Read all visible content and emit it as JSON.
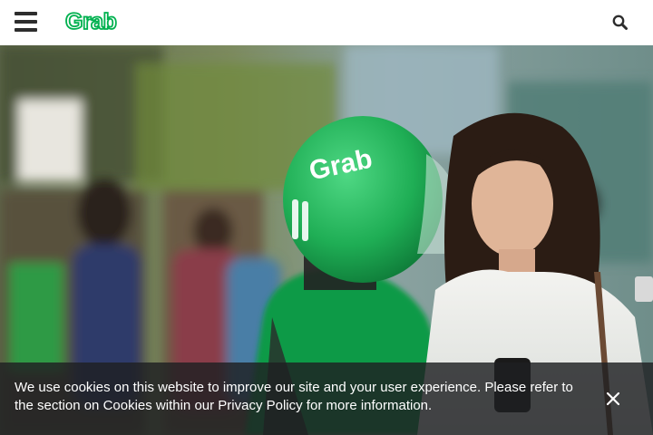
{
  "header": {
    "menu_icon": "hamburger-menu-icon",
    "logo_text": "Grab",
    "search_icon": "search-icon"
  },
  "colors": {
    "brand_green": "#00b14f",
    "header_bg": "#ffffff",
    "icon_dark": "#2d2d2d",
    "banner_bg": "#1e2022"
  },
  "hero": {
    "image_icon": "grab-driver-and-passenger-photo"
  },
  "cookie_banner": {
    "message": "We use cookies on this website to improve our site and your user experience. Please refer to the section on Cookies within our Privacy Policy for more information.",
    "close_icon": "close-icon"
  }
}
